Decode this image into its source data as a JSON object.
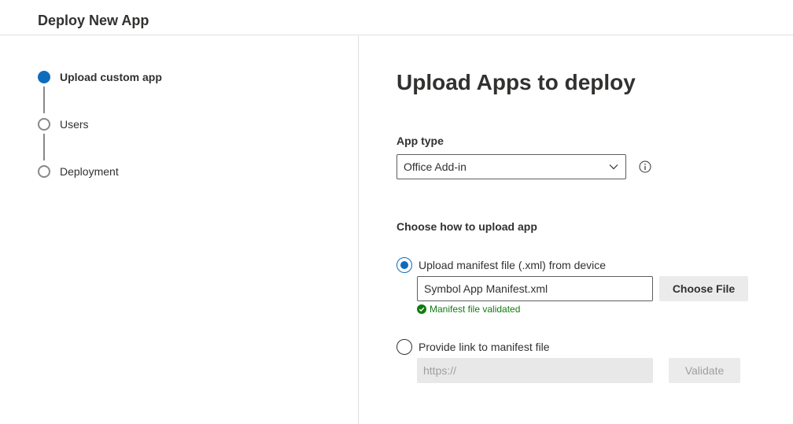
{
  "header": {
    "title": "Deploy New App"
  },
  "steps": [
    {
      "label": "Upload custom app",
      "state": "active"
    },
    {
      "label": "Users",
      "state": "pending"
    },
    {
      "label": "Deployment",
      "state": "pending"
    }
  ],
  "main": {
    "title": "Upload Apps to deploy",
    "app_type": {
      "label": "App type",
      "selected": "Office Add-in",
      "info_icon": "info-icon"
    },
    "upload_method": {
      "label": "Choose how to upload app",
      "options": [
        {
          "label": "Upload manifest file (.xml) from device",
          "checked": true,
          "file_value": "Symbol App Manifest.xml",
          "button_label": "Choose File",
          "validation_text": "Manifest file validated"
        },
        {
          "label": "Provide link to manifest file",
          "checked": false,
          "placeholder": "https://",
          "button_label": "Validate"
        }
      ]
    }
  },
  "colors": {
    "accent": "#0f6cbd",
    "success": "#107c10",
    "border": "#e1dfdd"
  }
}
